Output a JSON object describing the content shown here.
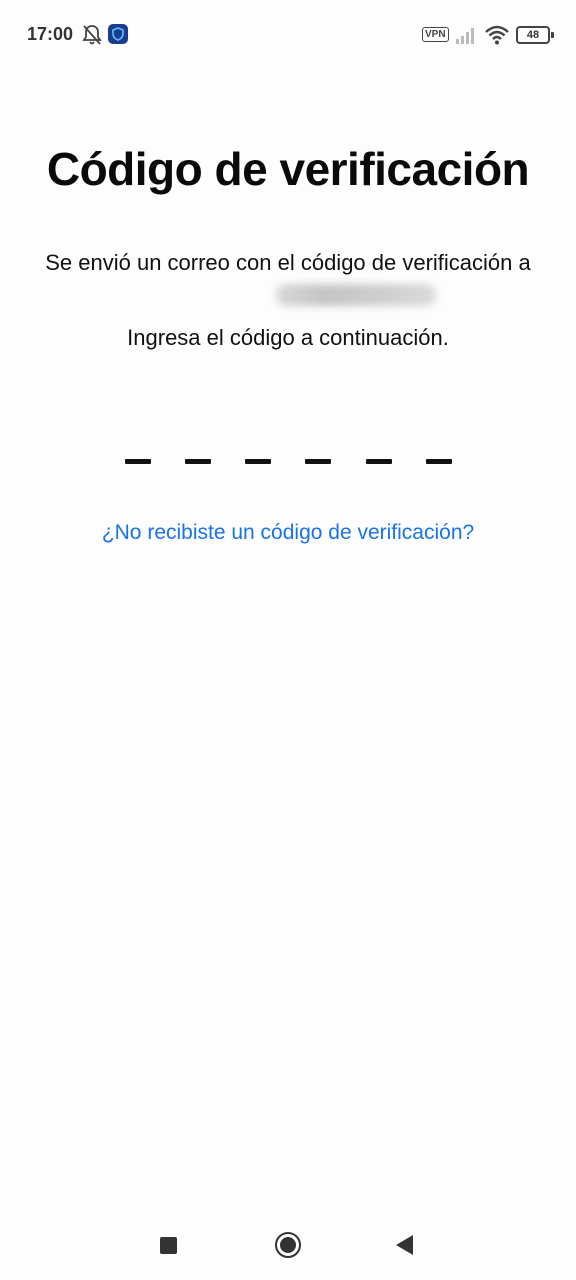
{
  "status_bar": {
    "time": "17:00",
    "icons": [
      "bell-off-icon",
      "shield-app-icon",
      "vpn-icon",
      "signal-icon",
      "wifi-icon",
      "battery-icon"
    ],
    "vpn_label": "VPN",
    "battery_level": "48"
  },
  "main": {
    "title": "Código de verificación",
    "description_line1": "Se envió un correo con el código de verificación a",
    "email_visible": "@outlook.com",
    "description_line2": "Ingresa el código a continuación.",
    "code_slot_count": 6,
    "resend_link": "¿No recibiste un código de verificación?",
    "link_color": "#1a73e8"
  },
  "nav_bar": {
    "buttons": [
      "recent-apps-button",
      "home-button",
      "back-button"
    ]
  }
}
